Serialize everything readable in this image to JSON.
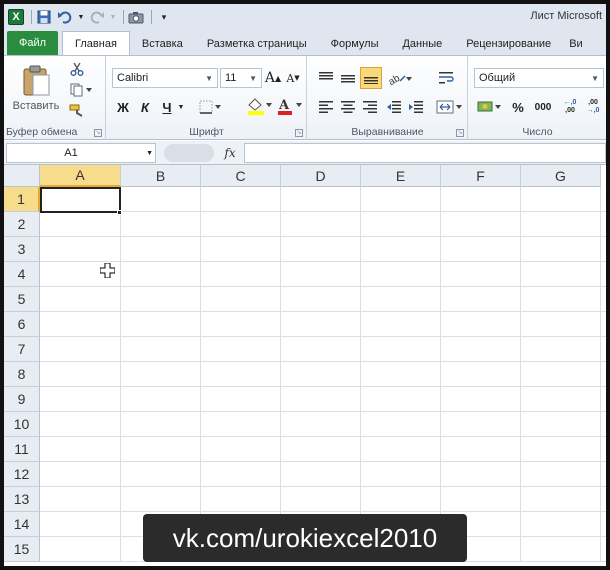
{
  "window": {
    "title": "Лист Microsoft"
  },
  "ribbon_tabs": [
    {
      "label": "Файл"
    },
    {
      "label": "Главная"
    },
    {
      "label": "Вставка"
    },
    {
      "label": "Разметка страницы"
    },
    {
      "label": "Формулы"
    },
    {
      "label": "Данные"
    },
    {
      "label": "Рецензирование"
    },
    {
      "label": "Ви"
    }
  ],
  "clipboard": {
    "paste_label": "Вставить",
    "group_label": "Буфер обмена"
  },
  "font": {
    "name": "Calibri",
    "size": "11",
    "bold": "Ж",
    "italic": "К",
    "underline": "Ч",
    "group_label": "Шрифт"
  },
  "alignment": {
    "group_label": "Выравнивание"
  },
  "number": {
    "format": "Общий",
    "percent": "%",
    "thousands": "000",
    "inc_decimal": "+,0\n,00",
    "dec_decimal": ",00\n+,0",
    "group_label": "Число"
  },
  "formula_bar": {
    "name_box": "A1",
    "fx": "fx",
    "value": ""
  },
  "grid": {
    "columns": [
      "A",
      "B",
      "C",
      "D",
      "E",
      "F",
      "G"
    ],
    "rows": [
      "1",
      "2",
      "3",
      "4",
      "5",
      "6",
      "7",
      "8",
      "9",
      "10",
      "11",
      "12",
      "13",
      "14",
      "15"
    ],
    "active_cell": "A1"
  },
  "watermark": {
    "text": "vk.com/urokiexcel2010"
  },
  "colors": {
    "file_tab": "#2a8c3f",
    "selection_header": "#f7dc8b",
    "excel_green": "#1d7a3b"
  }
}
